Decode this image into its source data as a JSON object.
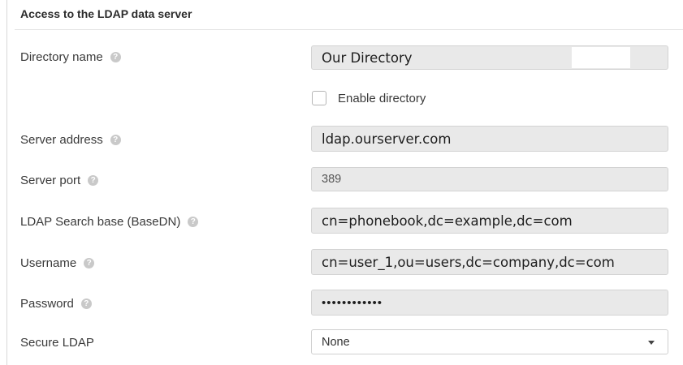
{
  "section": {
    "title": "Access to the LDAP data server"
  },
  "help_glyph": "?",
  "fields": {
    "directory_name": {
      "label": "Directory name",
      "value": "Our Directory"
    },
    "enable_directory": {
      "label": "Enable directory",
      "checked": false
    },
    "server_address": {
      "label": "Server address",
      "value": "ldap.ourserver.com"
    },
    "server_port": {
      "label": "Server port",
      "value": "389"
    },
    "search_base": {
      "label": "LDAP Search base (BaseDN)",
      "value": "cn=phonebook,dc=example,dc=com"
    },
    "username": {
      "label": "Username",
      "value": "cn=user_1,ou=users,dc=company,dc=com"
    },
    "password": {
      "label": "Password",
      "value": "••••••••••••"
    },
    "secure_ldap": {
      "label": "Secure LDAP",
      "value": "None",
      "options": [
        "None"
      ]
    }
  },
  "colors": {
    "field_bg": "#e9e9e9",
    "field_border": "#d3d3d3",
    "help_icon": "#c9c9c9"
  }
}
